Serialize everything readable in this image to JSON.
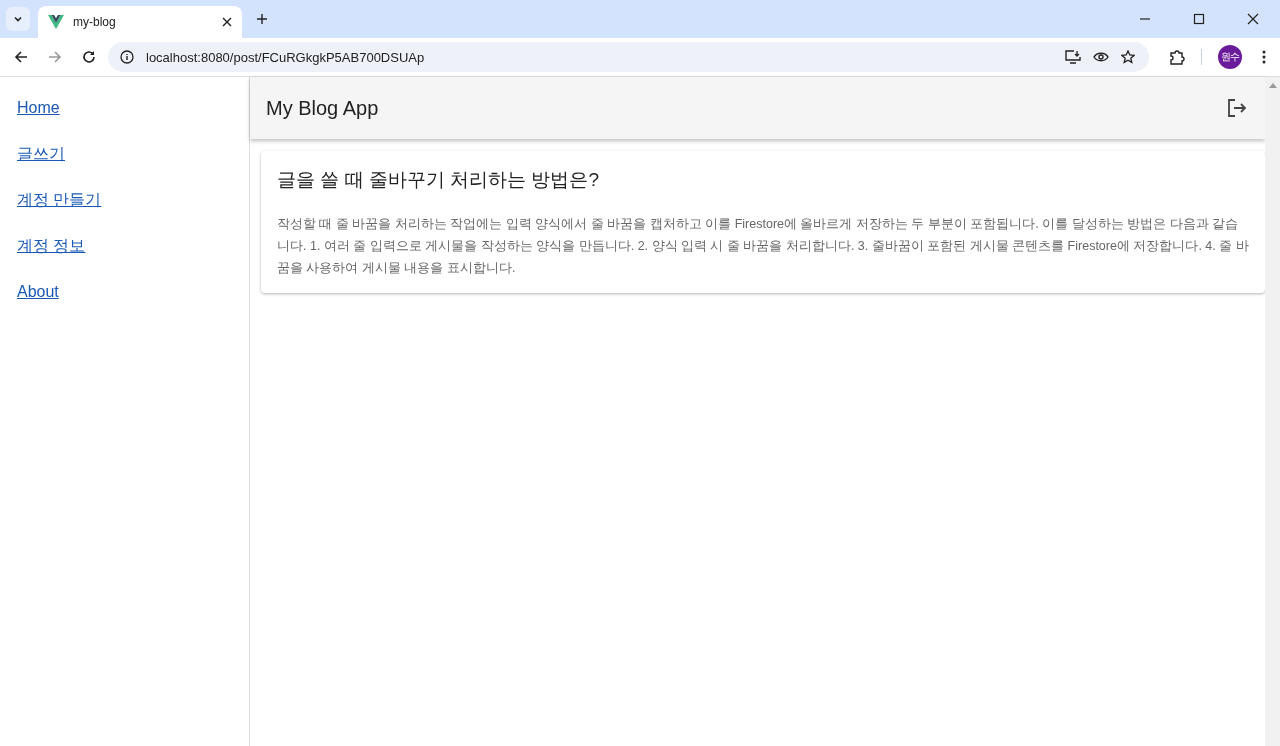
{
  "browser": {
    "tab_title": "my-blog",
    "url": "localhost:8080/post/FCuRGkgkP5AB700DSUAp",
    "profile": "원수"
  },
  "sidebar": {
    "items": [
      {
        "label": "Home"
      },
      {
        "label": "글쓰기"
      },
      {
        "label": "계정 만들기"
      },
      {
        "label": "계정 정보"
      },
      {
        "label": "About"
      }
    ]
  },
  "app_bar": {
    "title": "My Blog App"
  },
  "post": {
    "title": "글을 쓸 때 줄바꾸기 처리하는 방법은?",
    "body": "작성할 때 줄 바꿈을 처리하는 작업에는 입력 양식에서 줄 바꿈을 캡처하고 이를 Firestore에 올바르게 저장하는 두 부분이 포함됩니다. 이를 달성하는 방법은 다음과 같습니다. 1. 여러 줄 입력으로 게시물을 작성하는 양식을 만듭니다. 2. 양식 입력 시 줄 바꿈을 처리합니다. 3. 줄바꿈이 포함된 게시물 콘텐츠를 Firestore에 저장합니다. 4. 줄 바꿈을 사용하여 게시물 내용을 표시합니다."
  }
}
